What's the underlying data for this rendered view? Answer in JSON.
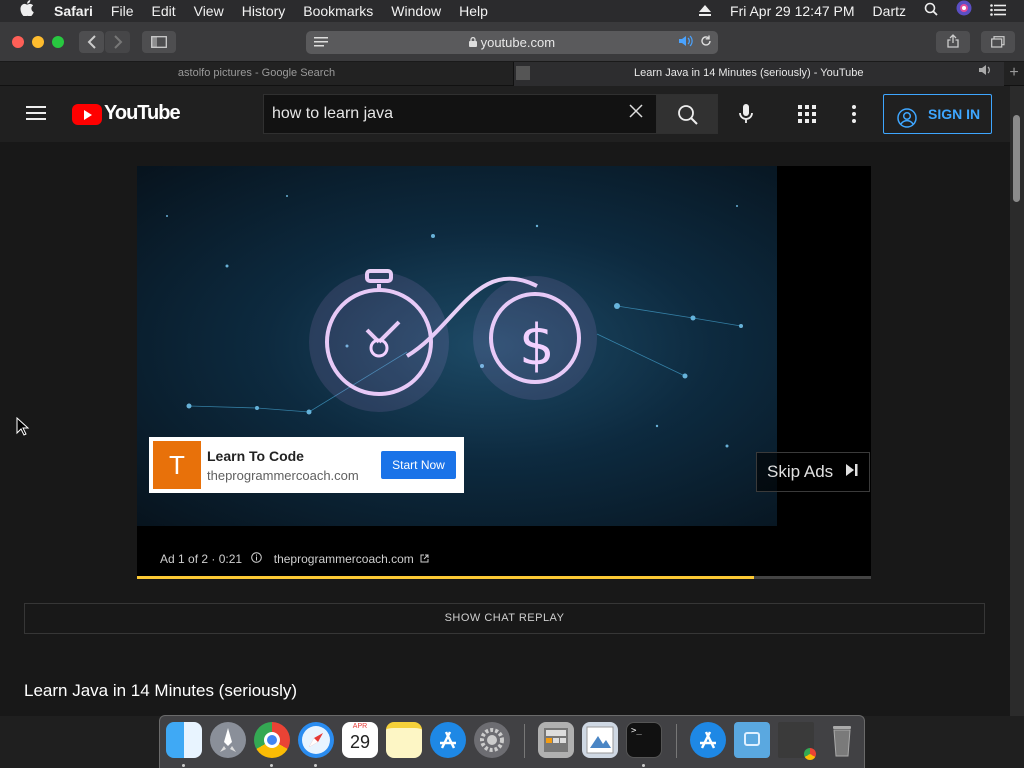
{
  "menubar": {
    "apple": "",
    "app": "Safari",
    "items": [
      "File",
      "Edit",
      "View",
      "History",
      "Bookmarks",
      "Window",
      "Help"
    ],
    "clock": "Fri Apr 29  12:47 PM",
    "user": "Dartz"
  },
  "toolbar": {
    "url": "youtube.com",
    "back_icon": "chevron-left-icon",
    "forward_icon": "chevron-right-icon"
  },
  "tabs": [
    {
      "title": "astolfo pictures - Google Search",
      "active": false
    },
    {
      "title": "Learn Java in 14 Minutes (seriously) - YouTube",
      "active": true
    }
  ],
  "youtube": {
    "logo_text": "YouTube",
    "search_value": "how to learn java",
    "sign_in_label": "SIGN IN",
    "accent": "#3ea6ff",
    "ad_overlay": {
      "letter": "T",
      "title": "Learn To Code",
      "domain": "theprogrammercoach.com",
      "cta": "Start Now"
    },
    "skip_label": "Skip Ads",
    "ad_info": "Ad 1 of 2 · 0:21",
    "ad_link": "theprogrammercoach.com",
    "ad_progress_fraction": 0.84,
    "chat_label": "SHOW CHAT REPLAY",
    "video_title": "Learn Java in 14 Minutes (seriously)"
  },
  "dock": {
    "calendar_month": "APR",
    "calendar_day": "29",
    "apps": [
      "Finder",
      "Launchpad",
      "Google Chrome",
      "Safari",
      "Calendar",
      "Notes",
      "App Store",
      "System Preferences",
      "Calculator",
      "Preview",
      "Terminal",
      "Downloads",
      "Documents",
      "Chrome Window",
      "Trash"
    ]
  }
}
